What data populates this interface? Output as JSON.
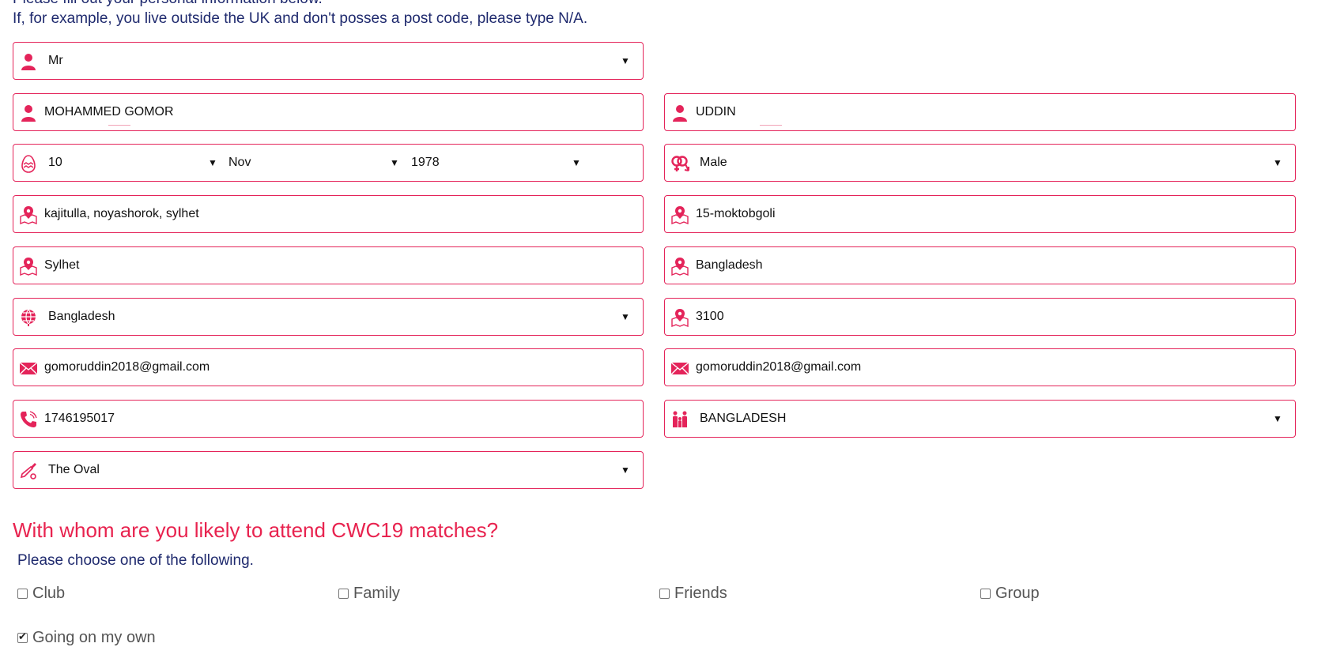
{
  "intro": {
    "line1": "Please fill out your personal information below.",
    "line2": "If, for example, you live outside the UK and don't posses a post code, please type N/A."
  },
  "form": {
    "title": "Mr",
    "first_name": "MOHAMMED GOMOR",
    "last_name": "UDDIN",
    "dob": {
      "day": "10",
      "month": "Nov",
      "year": "1978"
    },
    "gender": "Male",
    "address_line1": "kajitulla, noyashorok, sylhet",
    "address_line2": "15-moktobgoli",
    "city": "Sylhet",
    "county": "Bangladesh",
    "country": "Bangladesh",
    "postcode": "3100",
    "email": "gomoruddin2018@gmail.com",
    "email_confirm": "gomoruddin2018@gmail.com",
    "phone": "1746195017",
    "team_supported": "BANGLADESH",
    "venue": "The Oval"
  },
  "attend": {
    "heading": "With whom are you likely to attend CWC19 matches?",
    "subheading": "Please choose one of the following.",
    "options": [
      {
        "label": "Club",
        "checked": false
      },
      {
        "label": "Family",
        "checked": false
      },
      {
        "label": "Friends",
        "checked": false
      },
      {
        "label": "Group",
        "checked": false
      },
      {
        "label": "Going on my own",
        "checked": true
      }
    ]
  },
  "colors": {
    "accent": "#e4245a",
    "heading": "#e8234f",
    "text_blue": "#1f2a6e"
  },
  "icons": {
    "title": "person-icon",
    "first_name": "person-icon",
    "last_name": "person-icon",
    "dob": "egg-icon",
    "gender": "gender-icon",
    "address": "map-pin-icon",
    "country": "globe-icon",
    "email": "envelope-icon",
    "phone": "phone-icon",
    "team": "family-icon",
    "venue": "cricket-bat-icon"
  }
}
